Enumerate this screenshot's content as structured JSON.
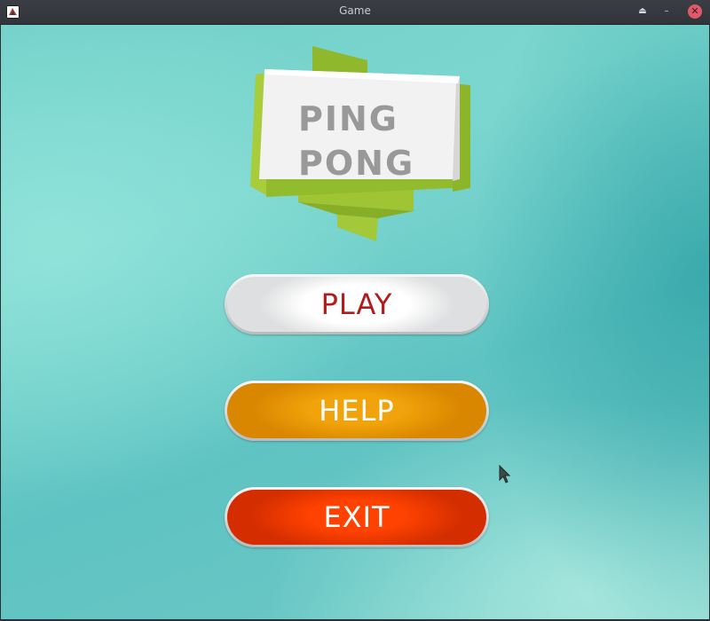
{
  "window": {
    "title": "Game",
    "controls": {
      "keep_above_icon": "eject-icon",
      "minimize_icon": "minimize-icon",
      "close_icon": "close-icon"
    }
  },
  "logo": {
    "line1": "PING",
    "line2": "PONG",
    "ribbon_color": "#9bc633",
    "text_color": "#999999"
  },
  "menu": {
    "play_label": "PLAY",
    "help_label": "HELP",
    "exit_label": "EXIT"
  },
  "colors": {
    "background_teal": "#6fcfc8",
    "play_text": "#b11c1c",
    "help_fill": "#f0a30a",
    "exit_fill": "#ff4200"
  }
}
